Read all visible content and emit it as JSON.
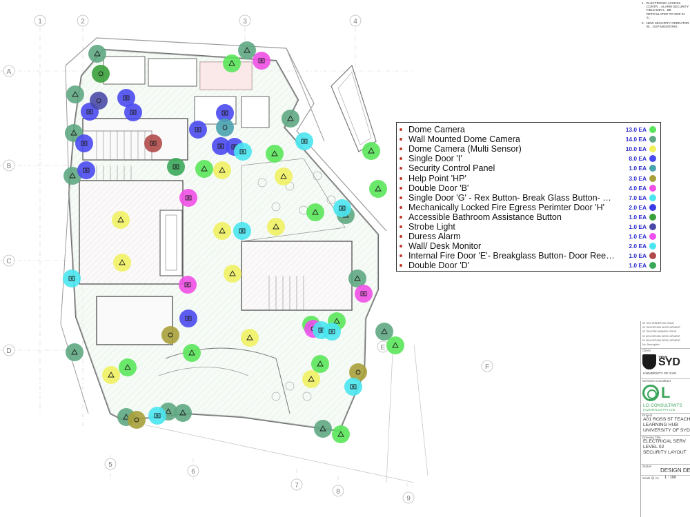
{
  "notes": [
    {
      "num": "1.",
      "text": "ELECTRONIC ACCESS CONTR... ALARM SECURITY FIELD DEVI... BE RETICULATED TO SDP IN S..."
    },
    {
      "num": "2.",
      "text": "NEW SECURITY OPERATOR W... SGP MONITORS."
    }
  ],
  "grid_labels": {
    "columns_top": [
      "1",
      "2",
      "3",
      "4"
    ],
    "rows_left": [
      "A",
      "B",
      "C",
      "D"
    ],
    "right": [
      "E",
      "F"
    ],
    "bottom": [
      "5",
      "6",
      "7",
      "8",
      "9"
    ]
  },
  "legend": {
    "items": [
      {
        "label": "Dome Camera",
        "count": "13.0 EA",
        "color": "#5ae65a"
      },
      {
        "label": "Wall Mounted Dome Camera",
        "count": "14.0 EA",
        "color": "#5fa883"
      },
      {
        "label": "Dome Camera (Multi Sensor)",
        "count": "10.0 EA",
        "color": "#f0f05a"
      },
      {
        "label": "Single Door 'I'",
        "count": "8.0 EA",
        "color": "#4a4af0"
      },
      {
        "label": "Security Control Panel",
        "count": "1.0 EA",
        "color": "#4aa3b0"
      },
      {
        "label": "Help Point 'HP'",
        "count": "3.0 EA",
        "color": "#a8a03a"
      },
      {
        "label": "Double Door 'B'",
        "count": "4.0 EA",
        "color": "#f050e6"
      },
      {
        "label": "Single Door 'G' - Rex Button- Break Glass Button- Door ...",
        "count": "7.0 EA",
        "color": "#4ae6f0"
      },
      {
        "label": "Mechanically Locked Fire Egress Perimter Door 'H'",
        "count": "2.0 EA",
        "color": "#3a3ae6"
      },
      {
        "label": "Accessible Bathroom Assistance Button",
        "count": "1.0 EA",
        "color": "#3aa03a"
      },
      {
        "label": "Strobe Light",
        "count": "1.0 EA",
        "color": "#4a4aa8"
      },
      {
        "label": "Duress Alarm",
        "count": "1.0 EA",
        "color": "#f050f0"
      },
      {
        "label": "Wall/ Desk Monitor",
        "count": "2.0 EA",
        "color": "#4ae6f0"
      },
      {
        "label": "Internal Fire Door 'E'- Breakglass Button- Door Reed Sw...",
        "count": "1.0 EA",
        "color": "#b04a4a"
      },
      {
        "label": "Double Door 'D'",
        "count": "1.0 EA",
        "color": "#3aa85a"
      }
    ]
  },
  "title_block": {
    "revisions": [
      "05  75% TENDER DD ISSUE",
      "04  75% DESIGN DEVELOPMENT",
      "03  75% PRELIMINARY ISSUE",
      "02  60% DESIGN DEVELOPMENT",
      "01  60% DESIGN DEVELOPMENT"
    ],
    "rev_header": "No.  Description",
    "client_label": "Client",
    "client_logo_small": "THE UNI",
    "client_logo_big": "SYD",
    "client_name": "UNIVERSITY OF SYD",
    "consultant_label": "Services Consultant",
    "consultant_logo_letter": "L",
    "consultant_name": "LCI CONSULTANTS",
    "consultant_sub": "(AUSTRALIA) PTY LTD",
    "project_label": "Project",
    "project_lines": [
      "A01 ROSS ST TEACHI",
      "LEARNING HUB",
      "UNIVERSITY OF SYD"
    ],
    "drawing_title_label": "Drawing Title",
    "drawing_title_lines": [
      "ELECTRICAL SERV",
      "LEVEL 02",
      "SECURITY LAYOUT"
    ],
    "status_label": "Status",
    "status": "DESIGN DE",
    "scale_label": "Scale @ A1",
    "scale": "1 : 100"
  },
  "markers": [
    {
      "type": "wall-dome-camera"
    },
    {
      "type": "wall-dome-camera"
    },
    {
      "type": "wall-dome-camera"
    },
    {
      "type": "wall-dome-camera"
    },
    {
      "type": "wall-dome-camera"
    },
    {
      "type": "wall-dome-camera"
    },
    {
      "type": "wall-dome-camera"
    },
    {
      "type": "wall-dome-camera"
    },
    {
      "type": "wall-dome-camera"
    },
    {
      "type": "wall-dome-camera"
    },
    {
      "type": "wall-dome-camera"
    },
    {
      "type": "wall-dome-camera"
    },
    {
      "type": "wall-dome-camera"
    },
    {
      "type": "wall-dome-camera"
    },
    {
      "type": "dome-camera"
    },
    {
      "type": "dome-camera"
    },
    {
      "type": "dome-camera"
    },
    {
      "type": "dome-camera"
    },
    {
      "type": "dome-camera"
    },
    {
      "type": "dome-camera"
    },
    {
      "type": "dome-camera"
    },
    {
      "type": "dome-camera"
    },
    {
      "type": "dome-camera"
    },
    {
      "type": "dome-camera"
    },
    {
      "type": "dome-camera"
    },
    {
      "type": "dome-camera"
    },
    {
      "type": "dome-camera"
    },
    {
      "type": "multi-sensor-camera"
    },
    {
      "type": "multi-sensor-camera"
    },
    {
      "type": "multi-sensor-camera"
    },
    {
      "type": "multi-sensor-camera"
    },
    {
      "type": "multi-sensor-camera"
    },
    {
      "type": "multi-sensor-camera"
    },
    {
      "type": "multi-sensor-camera"
    },
    {
      "type": "multi-sensor-camera"
    },
    {
      "type": "multi-sensor-camera"
    },
    {
      "type": "multi-sensor-camera"
    },
    {
      "type": "single-door-i"
    },
    {
      "type": "single-door-i"
    },
    {
      "type": "single-door-i"
    },
    {
      "type": "single-door-i"
    },
    {
      "type": "single-door-i"
    },
    {
      "type": "single-door-i"
    },
    {
      "type": "single-door-i"
    },
    {
      "type": "single-door-i"
    },
    {
      "type": "single-door-i"
    },
    {
      "type": "single-door-i"
    },
    {
      "type": "security-control-panel"
    },
    {
      "type": "help-point"
    },
    {
      "type": "help-point"
    },
    {
      "type": "help-point"
    },
    {
      "type": "double-door-b"
    },
    {
      "type": "double-door-b"
    },
    {
      "type": "double-door-b"
    },
    {
      "type": "double-door-b"
    },
    {
      "type": "duress-alarm"
    },
    {
      "type": "single-door-g"
    },
    {
      "type": "single-door-g"
    },
    {
      "type": "single-door-g"
    },
    {
      "type": "single-door-g"
    },
    {
      "type": "single-door-g"
    },
    {
      "type": "single-door-g"
    },
    {
      "type": "single-door-g"
    },
    {
      "type": "single-door-g"
    },
    {
      "type": "single-door-g"
    },
    {
      "type": "strobe-light"
    },
    {
      "type": "bathroom-assist-button"
    },
    {
      "type": "double-door-d"
    },
    {
      "type": "internal-fire-door"
    }
  ]
}
